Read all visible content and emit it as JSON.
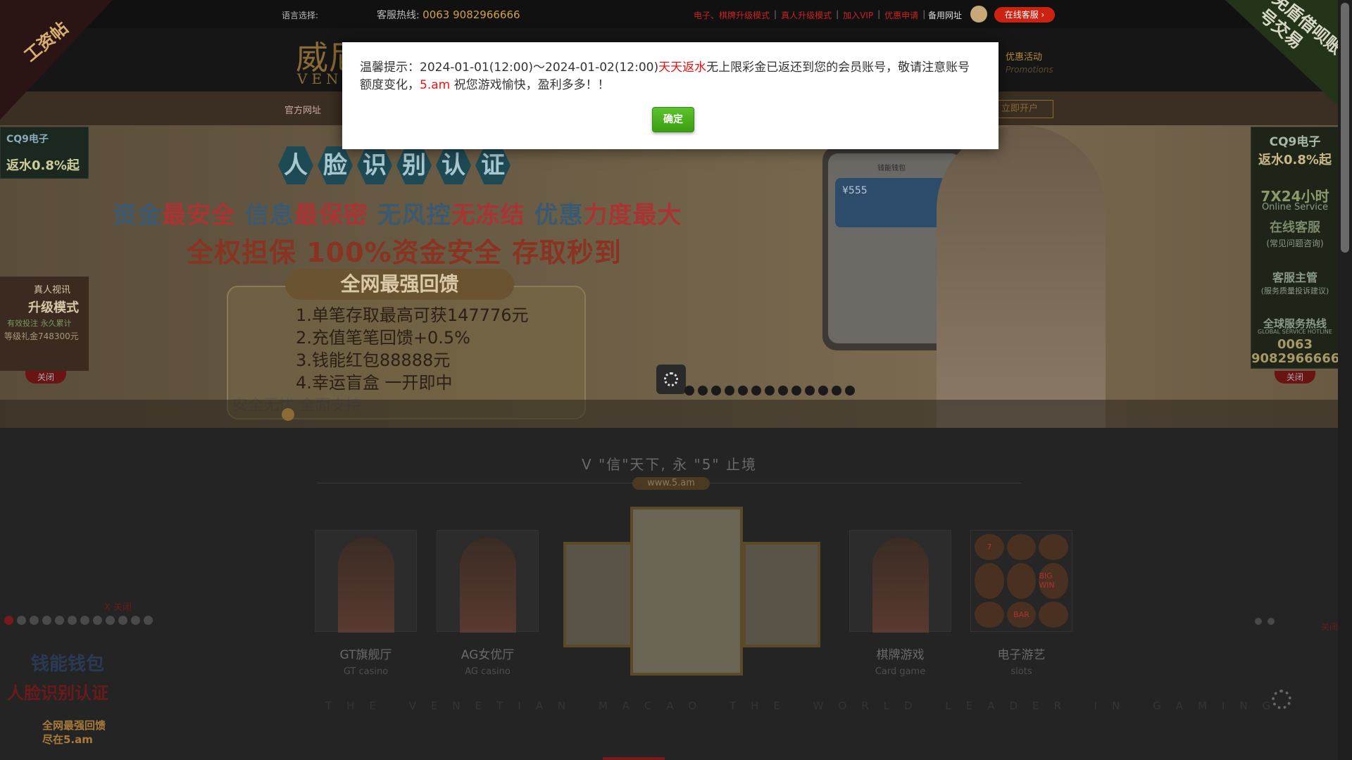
{
  "topbar": {
    "language_label": "语言选择:",
    "hotline_label": "客服热线:",
    "hotline_number": "0063 9082966666",
    "links": [
      "电子、棋牌升级模式",
      "真人升级模式",
      "加入VIP",
      "优惠申请"
    ],
    "backup_url": "备用网址",
    "online_cs": "在线客服 ›"
  },
  "header": {
    "logo_text": "威尼",
    "logo_sub": "VEN",
    "promo": "优惠活动",
    "promo_sub": "Promotions"
  },
  "navbar": {
    "official": "官方网址",
    "open_account": "立即开户"
  },
  "banner": {
    "face_chars": [
      "人",
      "脸",
      "识",
      "别",
      "认",
      "证"
    ],
    "line1_parts": [
      "资金",
      "最安全",
      " 信息",
      "最保密",
      " 无风控",
      "无冻结",
      " 优惠",
      "力度最大"
    ],
    "line2": "全权担保 100%资金安全 存取秒到",
    "feedback_title": "全网最强回馈",
    "feedback_items": [
      "1.单笔存取最高可获147776元",
      "2.充值笔笔回馈+0.5%",
      "3.钱能红包88888元",
      "4.幸运盲盒 一开即中"
    ],
    "pay_line": "安全无忧  全面支持",
    "wallet_title": "钱能钱包",
    "wallet_amount": "¥555",
    "slide_count": 13
  },
  "section2": {
    "title": "V \"信\"天下, 永 \"5\" 止境",
    "url": "www.5.am",
    "games": [
      {
        "name": "GT旗舰厅",
        "en": "GT casino"
      },
      {
        "name": "AG女优厅",
        "en": "AG casino"
      },
      {
        "name": "棋牌游戏",
        "en": "Card game"
      },
      {
        "name": "电子游艺",
        "en": "slots"
      }
    ],
    "slot_symbols": [
      "7",
      "",
      "",
      "",
      "",
      "BIG WIN",
      "",
      "BAR",
      ""
    ],
    "tagline": "THE VENETIAN MACAO THE WORLD LEADER IN GAMING"
  },
  "floats": {
    "corner_left": "工资帖",
    "corner_right": "免盾借呗账号交易",
    "left_top_brand": "CQ9电子",
    "left_top_rebate": "返水0.8%起",
    "left_mid": [
      "真人视讯",
      "升级模式",
      "有效投注 永久累计",
      "等级礼金748300元"
    ],
    "close": "关闭",
    "right_items": [
      "CQ9电子",
      "返水0.8%起",
      "7X24小时",
      "Online Service",
      "在线客服",
      "(常见问题咨询)",
      "客服主管",
      "(服务质量投诉建议)",
      "全球服务热线",
      "GLOBAL SERVICE HOTLINE",
      "0063",
      "9082966666"
    ],
    "x_close": "X 关闭",
    "left_bottom_ad": [
      "钱能钱包",
      "人脸识别认证",
      "全网最强回馈",
      "尽在5.am"
    ],
    "right_close": "关闭",
    "left_dot_count": 12,
    "right_dot_count": 2
  },
  "modal": {
    "prefix": "温馨提示：2024-01-01(12:00)～2024-01-02(12:00)",
    "highlight1": "天天返水",
    "middle": "无上限彩金已返还到您的会员账号，敬请注意账号额度变化，",
    "highlight2": "5.am",
    "suffix": " 祝您游戏愉快，盈利多多！！",
    "ok_label": "确定"
  }
}
